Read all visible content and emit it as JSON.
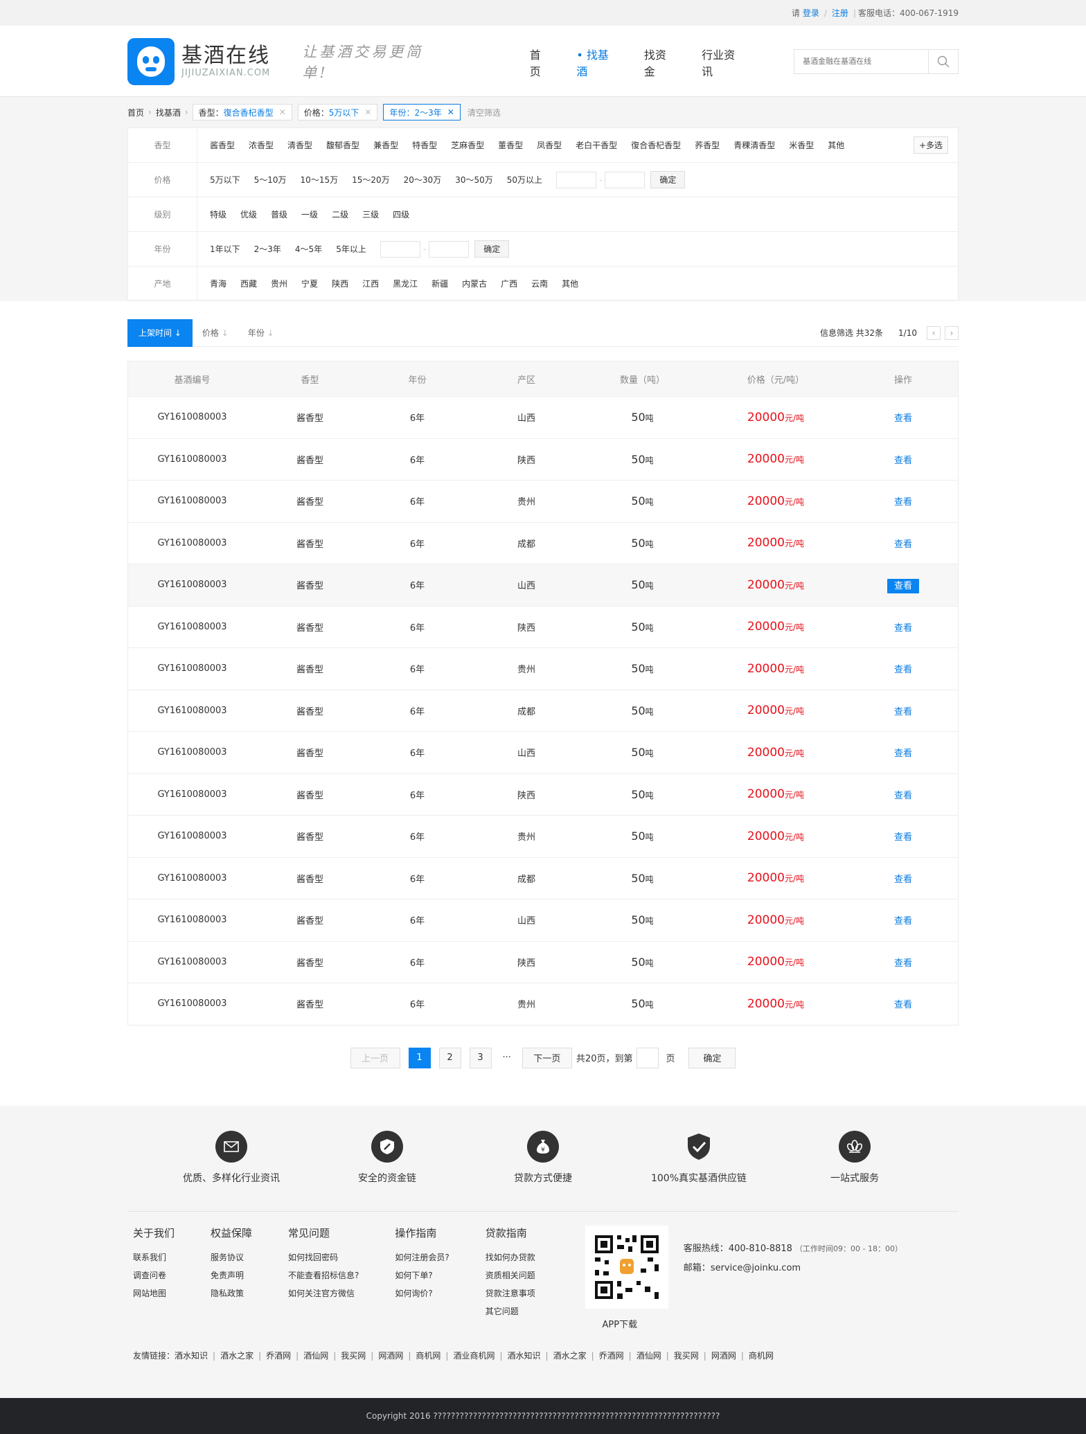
{
  "topbar": {
    "please": "请",
    "login": "登录",
    "slash": "/",
    "register": "注册",
    "hotline": "客服电话：400-067-1919"
  },
  "header": {
    "logo_cn": "基酒在线",
    "logo_en": "JIJIUZAIXIAN.COM",
    "slogan": "让基酒交易更简单!",
    "nav": [
      "首页",
      "找基酒",
      "找资金",
      "行业资讯"
    ],
    "nav_active": 1,
    "search_placeholder": "基酒金融在基酒在线"
  },
  "crumb": {
    "home": "首页",
    "current": "找基酒",
    "chips": [
      {
        "k": "香型：",
        "v": "復合香杞香型"
      },
      {
        "k": "价格：",
        "v": "5万以下"
      },
      {
        "k": "年份：",
        "v": "2～3年"
      }
    ],
    "clear": "清空筛选"
  },
  "filters": {
    "xiangxing": {
      "label": "香型",
      "opts": [
        "酱香型",
        "浓香型",
        "清香型",
        "馥郁香型",
        "兼香型",
        "特香型",
        "芝麻香型",
        "董香型",
        "凤香型",
        "老白干香型",
        "復合香杞香型",
        "荞香型",
        "青稞清香型",
        "米香型",
        "其他"
      ],
      "more": "+多选"
    },
    "price": {
      "label": "价格",
      "opts": [
        "5万以下",
        "5～10万",
        "10～15万",
        "15～20万",
        "20～30万",
        "30～50万",
        "50万以上"
      ],
      "ok": "确定"
    },
    "level": {
      "label": "级别",
      "opts": [
        "特级",
        "优级",
        "普级",
        "一级",
        "二级",
        "三级",
        "四级"
      ]
    },
    "year": {
      "label": "年份",
      "opts": [
        "1年以下",
        "2～3年",
        "4～5年",
        "5年以上"
      ],
      "ok": "确定"
    },
    "origin": {
      "label": "产地",
      "opts": [
        "青海",
        "西藏",
        "贵州",
        "宁夏",
        "陕西",
        "江西",
        "黑龙江",
        "新疆",
        "内蒙古",
        "广西",
        "云南",
        "其他"
      ]
    }
  },
  "sort": {
    "tabs": [
      "上架时间",
      "价格",
      "年份"
    ],
    "info": "信息筛选 共32条",
    "page": "1/10"
  },
  "table": {
    "headers": [
      "基酒编号",
      "香型",
      "年份",
      "产区",
      "数量（吨）",
      "价格（元/吨）",
      "操作"
    ],
    "rows": [
      {
        "id": "GY1610080003",
        "type": "酱香型",
        "year": "6年",
        "area": "山西",
        "qty": "50",
        "qty_u": "吨",
        "price": "20000",
        "price_u": "元/吨",
        "op": "查看"
      },
      {
        "id": "GY1610080003",
        "type": "酱香型",
        "year": "6年",
        "area": "陕西",
        "qty": "50",
        "qty_u": "吨",
        "price": "20000",
        "price_u": "元/吨",
        "op": "查看"
      },
      {
        "id": "GY1610080003",
        "type": "酱香型",
        "year": "6年",
        "area": "贵州",
        "qty": "50",
        "qty_u": "吨",
        "price": "20000",
        "price_u": "元/吨",
        "op": "查看"
      },
      {
        "id": "GY1610080003",
        "type": "酱香型",
        "year": "6年",
        "area": "成都",
        "qty": "50",
        "qty_u": "吨",
        "price": "20000",
        "price_u": "元/吨",
        "op": "查看"
      },
      {
        "id": "GY1610080003",
        "type": "酱香型",
        "year": "6年",
        "area": "山西",
        "qty": "50",
        "qty_u": "吨",
        "price": "20000",
        "price_u": "元/吨",
        "op": "查看"
      },
      {
        "id": "GY1610080003",
        "type": "酱香型",
        "year": "6年",
        "area": "陕西",
        "qty": "50",
        "qty_u": "吨",
        "price": "20000",
        "price_u": "元/吨",
        "op": "查看"
      },
      {
        "id": "GY1610080003",
        "type": "酱香型",
        "year": "6年",
        "area": "贵州",
        "qty": "50",
        "qty_u": "吨",
        "price": "20000",
        "price_u": "元/吨",
        "op": "查看"
      },
      {
        "id": "GY1610080003",
        "type": "酱香型",
        "year": "6年",
        "area": "成都",
        "qty": "50",
        "qty_u": "吨",
        "price": "20000",
        "price_u": "元/吨",
        "op": "查看"
      },
      {
        "id": "GY1610080003",
        "type": "酱香型",
        "year": "6年",
        "area": "山西",
        "qty": "50",
        "qty_u": "吨",
        "price": "20000",
        "price_u": "元/吨",
        "op": "查看"
      },
      {
        "id": "GY1610080003",
        "type": "酱香型",
        "year": "6年",
        "area": "陕西",
        "qty": "50",
        "qty_u": "吨",
        "price": "20000",
        "price_u": "元/吨",
        "op": "查看"
      },
      {
        "id": "GY1610080003",
        "type": "酱香型",
        "year": "6年",
        "area": "贵州",
        "qty": "50",
        "qty_u": "吨",
        "price": "20000",
        "price_u": "元/吨",
        "op": "查看"
      },
      {
        "id": "GY1610080003",
        "type": "酱香型",
        "year": "6年",
        "area": "成都",
        "qty": "50",
        "qty_u": "吨",
        "price": "20000",
        "price_u": "元/吨",
        "op": "查看"
      },
      {
        "id": "GY1610080003",
        "type": "酱香型",
        "year": "6年",
        "area": "山西",
        "qty": "50",
        "qty_u": "吨",
        "price": "20000",
        "price_u": "元/吨",
        "op": "查看"
      },
      {
        "id": "GY1610080003",
        "type": "酱香型",
        "year": "6年",
        "area": "陕西",
        "qty": "50",
        "qty_u": "吨",
        "price": "20000",
        "price_u": "元/吨",
        "op": "查看"
      },
      {
        "id": "GY1610080003",
        "type": "酱香型",
        "year": "6年",
        "area": "贵州",
        "qty": "50",
        "qty_u": "吨",
        "price": "20000",
        "price_u": "元/吨",
        "op": "查看"
      }
    ],
    "highlight_row": 4
  },
  "pager": {
    "prev": "上一页",
    "pages": [
      "1",
      "2",
      "3"
    ],
    "ellipsis": "···",
    "next": "下一页",
    "total": "共20页，到第",
    "unit": "页",
    "ok": "确定"
  },
  "footer": {
    "features": [
      {
        "icon": "mail-icon",
        "text": "优质、多样化行业资讯"
      },
      {
        "icon": "shield-link-icon",
        "text": "安全的资金链"
      },
      {
        "icon": "money-bag-icon",
        "text": "贷款方式便捷"
      },
      {
        "icon": "shield-check-icon",
        "text": "100%真实基酒供应链"
      },
      {
        "icon": "lotus-icon",
        "text": "一站式服务"
      }
    ],
    "cols": [
      {
        "title": "关于我们",
        "items": [
          "联系我们",
          "调查问卷",
          "网站地图"
        ]
      },
      {
        "title": "权益保障",
        "items": [
          "服务协议",
          "免责声明",
          "隐私政策"
        ]
      },
      {
        "title": "常见问题",
        "items": [
          "如何找回密码",
          "不能查看招标信息?",
          "如何关注官方微信"
        ]
      },
      {
        "title": "操作指南",
        "items": [
          "如何注册会员?",
          "如何下单?",
          "如何询价?"
        ]
      },
      {
        "title": "贷款指南",
        "items": [
          "找如何办贷款",
          "资质相关问题",
          "贷款注意事项",
          "其它问题"
        ]
      }
    ],
    "app": "APP下载",
    "hotline_label": "客服热线：",
    "hotline": "400-810-8818",
    "hours": "（工作时间09：00 - 18：00）",
    "email_label": "邮箱：",
    "email": "service@joinku.com",
    "links_label": "友情链接：",
    "links": [
      "酒水知识",
      "酒水之家",
      "乔酒网",
      "酒仙网",
      "我买网",
      "网酒网",
      "商机网",
      "酒业商机网",
      "酒水知识",
      "酒水之家",
      "乔酒网",
      "酒仙网",
      "我买网",
      "网酒网",
      "商机网"
    ],
    "copyright": "Copyright 2016 ?????????????????????????????????????????????????????????????????"
  },
  "colors": {
    "accent": "#0a84f0",
    "price": "#e8101a",
    "footer_dark": "#222428"
  }
}
